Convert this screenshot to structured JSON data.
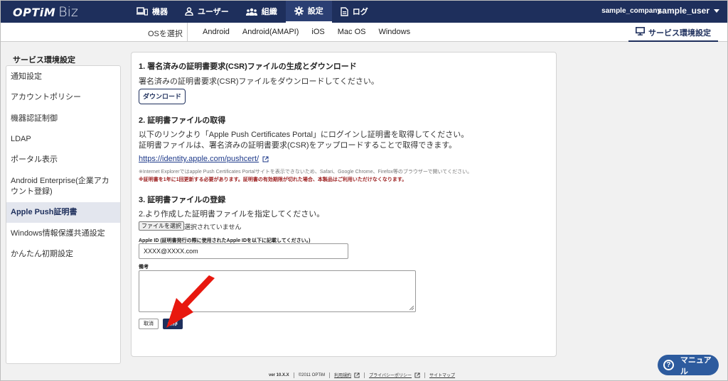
{
  "header": {
    "logo_brand": "OPTiM",
    "logo_product": "Biz",
    "nav": [
      {
        "label": "機器",
        "icon": "devices-icon"
      },
      {
        "label": "ユーザー",
        "icon": "user-icon"
      },
      {
        "label": "組織",
        "icon": "organization-icon"
      },
      {
        "label": "設定",
        "icon": "gear-icon",
        "active": true
      },
      {
        "label": "ログ",
        "icon": "log-icon"
      }
    ],
    "company": "sample_company",
    "user": "sample_user"
  },
  "osbar": {
    "label": "OSを選択",
    "tabs": [
      "Android",
      "Android(AMAPI)",
      "iOS",
      "Mac OS",
      "Windows"
    ],
    "service_tab": "サービス環境設定"
  },
  "sidebar": {
    "title": "サービス環境設定",
    "items": [
      {
        "label": "通知設定"
      },
      {
        "label": "アカウントポリシー"
      },
      {
        "label": "機器認証制御"
      },
      {
        "label": "LDAP"
      },
      {
        "label": "ポータル表示"
      },
      {
        "label": "Android Enterprise(企業アカウント登録)"
      },
      {
        "label": "Apple Push証明書",
        "active": true
      },
      {
        "label": "Windows情報保護共通設定"
      },
      {
        "label": "かんたん初期設定"
      }
    ]
  },
  "main": {
    "step1": {
      "heading": "1. 署名済みの証明書要求(CSR)ファイルの生成とダウンロード",
      "text": "署名済みの証明書要求(CSR)ファイルをダウンロードしてください。",
      "button": "ダウンロード"
    },
    "step2": {
      "heading": "2. 証明書ファイルの取得",
      "text1": "以下のリンクより「Apple Push Certificates Portal」にログインし証明書を取得してください。",
      "text2": "証明書ファイルは、署名済みの証明書要求(CSR)をアップロードすることで取得できます。",
      "link": "https://identity.apple.com/pushcert/",
      "note1": "※Internet Explorerではapple Push Certificates Portalサイトを表示できないため、Safari、Google Chrome、Firefox等のブラウザーで開いてください。",
      "note2": "※証明書を1年に1回更新する必要があります。証明書の有効期限が切れた場合、本製品はご利用いただけなくなります。"
    },
    "step3": {
      "heading": "3. 証明書ファイルの登録",
      "text": "2.より作成した証明書ファイルを指定してください。",
      "file_button": "ファイルを選択",
      "file_status": "選択されていません",
      "appleid_label": "Apple ID (証明書発行の際に使用されたApple IDを以下に記載してください。)",
      "appleid_value": "XXXX@XXXX.com",
      "memo_label": "備考",
      "memo_value": "",
      "cancel": "取消",
      "save": "保存"
    }
  },
  "footer": {
    "version": "ver 10.X.X",
    "copyright": "©2011 OPTiM",
    "terms": "利用規約",
    "privacy": "プライバシーポリシー",
    "sitemap": "サイトマップ"
  },
  "manual_button": "マニュアル",
  "colors": {
    "navy": "#1e2f5c",
    "annotation_arrow": "#e8180f",
    "manual_button": "#2d5b9e"
  }
}
